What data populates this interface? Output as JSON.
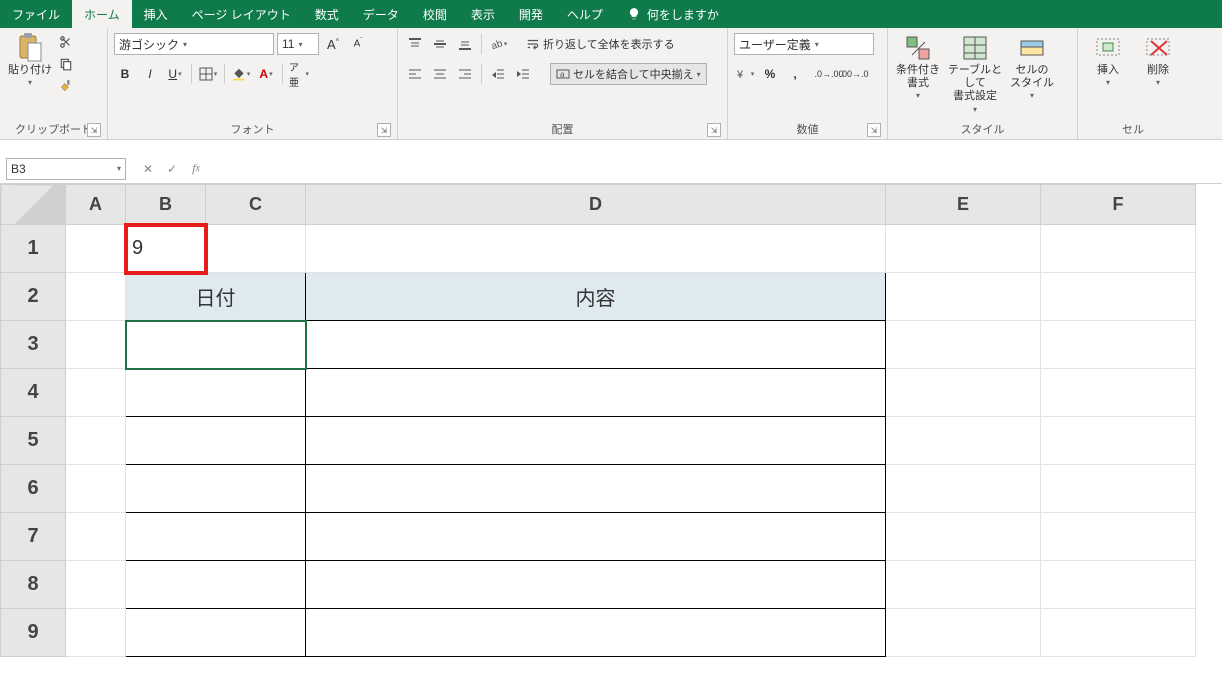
{
  "tabs": {
    "file": "ファイル",
    "home": "ホーム",
    "insert": "挿入",
    "page_layout": "ページ レイアウト",
    "formulas": "数式",
    "data": "データ",
    "review": "校閲",
    "view": "表示",
    "developer": "開発",
    "help": "ヘルプ",
    "tell_me": "何をしますか"
  },
  "ribbon": {
    "clipboard": {
      "paste": "貼り付け",
      "label": "クリップボード"
    },
    "font": {
      "name": "游ゴシック",
      "size": "11",
      "label": "フォント"
    },
    "alignment": {
      "wrap": "折り返して全体を表示する",
      "merge": "セルを結合して中央揃え",
      "label": "配置"
    },
    "number": {
      "format": "ユーザー定義",
      "label": "数値"
    },
    "styles": {
      "cond": "条件付き\n書式",
      "table": "テーブルとして\n書式設定",
      "cell": "セルの\nスタイル",
      "label": "スタイル"
    },
    "cells": {
      "insert": "挿入",
      "delete": "削除",
      "label": "セル"
    }
  },
  "formula_bar": {
    "ref": "B3",
    "value": ""
  },
  "sheet": {
    "columns": [
      "A",
      "B",
      "C",
      "D",
      "E",
      "F"
    ],
    "rows": [
      "1",
      "2",
      "3",
      "4",
      "5",
      "6",
      "7",
      "8",
      "9"
    ],
    "b1": "9",
    "header_date": "日付",
    "header_content": "内容"
  }
}
